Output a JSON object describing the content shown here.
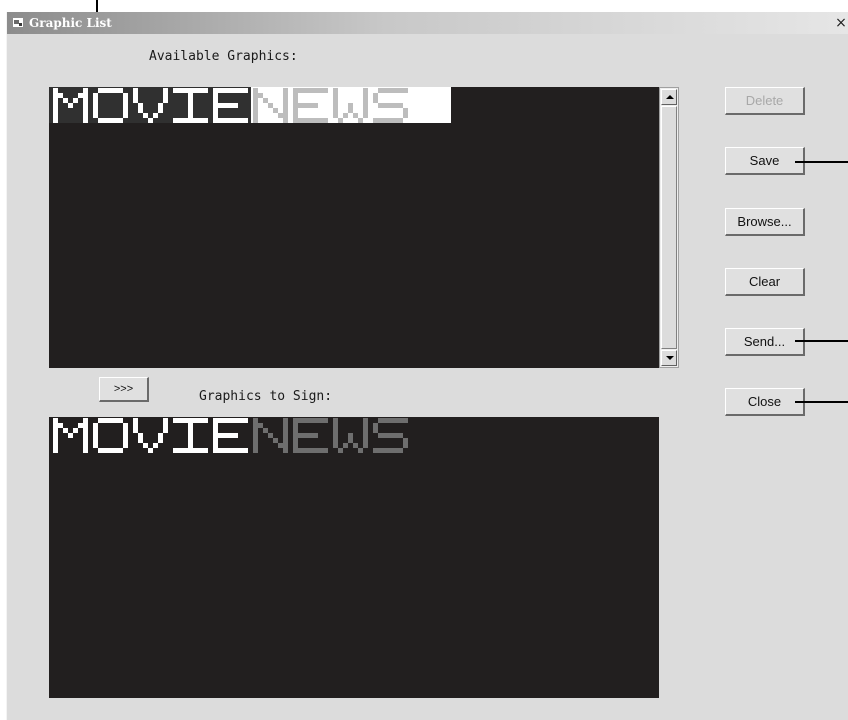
{
  "window": {
    "title": "Graphic List",
    "close_glyph": "×"
  },
  "labels": {
    "available": "Available Graphics:",
    "to_sign": "Graphics to Sign:"
  },
  "buttons": {
    "delete": "Delete",
    "save": "Save",
    "browse": "Browse...",
    "clear": "Clear",
    "send": "Send...",
    "close": "Close",
    "transfer": ">>>"
  },
  "graphic": {
    "word1": "MOVIE",
    "word2": "NEWS"
  },
  "icons": {
    "window_icon": "app-window-icon",
    "scroll_up": "scroll-up-arrow-icon",
    "scroll_down": "scroll-down-arrow-icon"
  },
  "colors": {
    "panel_bg": "#221f1f",
    "dialog_bg": "#dcdcdc",
    "movie_text": "#ffffff",
    "news_text_selected": "#bdbdbd",
    "news_text": "#6e6e6e"
  }
}
